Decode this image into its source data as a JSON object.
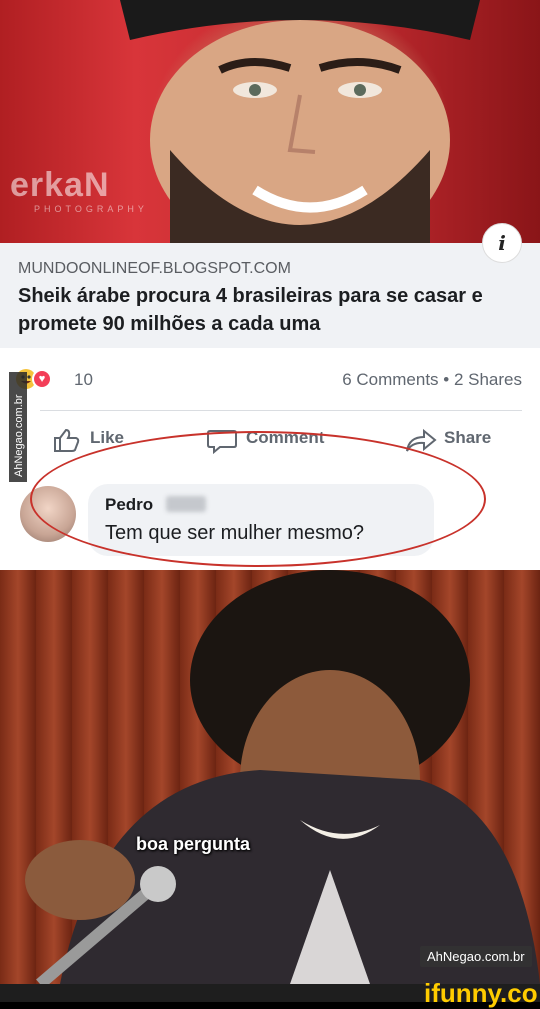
{
  "hero": {
    "watermark": "erkaN",
    "watermark_sub": "PHOTOGRAPHY",
    "info_label": "i"
  },
  "preview": {
    "domain": "MUNDOONLINEOF.BLOGSPOT.COM",
    "headline": "Sheik árabe procura 4 brasileiras para se casar e promete 90 milhões a cada uma"
  },
  "post": {
    "reaction_count": "10",
    "stats": "6 Comments • 2 Shares",
    "actions": {
      "like": "Like",
      "comment": "Comment",
      "share": "Share"
    },
    "side_watermark": "AhNegao.com.br"
  },
  "comment": {
    "author": "Pedro",
    "text": "Tem que ser mulher mesmo?"
  },
  "meme": {
    "caption": "boa pergunta",
    "watermark": "AhNegao.com.br"
  },
  "footer": {
    "brand": "ifunny.co"
  }
}
